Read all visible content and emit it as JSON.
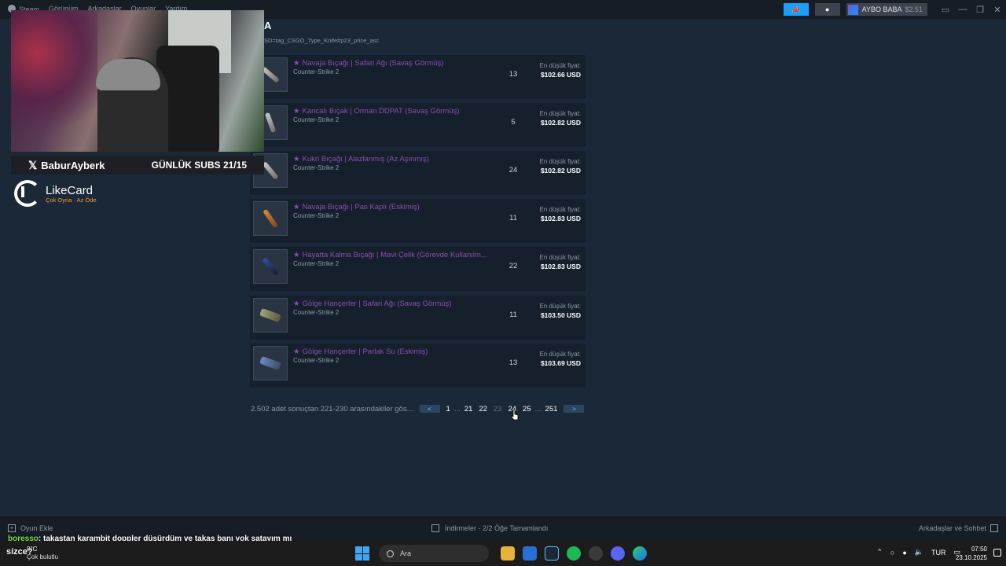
{
  "topbar": {
    "menu": [
      "Steam",
      "Görünüm",
      "Arkadaşlar",
      "Oyunlar",
      "Yardım"
    ],
    "username": "AYBO BABA",
    "balance": "$2.51"
  },
  "page": {
    "title": "A",
    "url_fragment": "SD=tag_CSGO_Type_Knife#p23_price_asc"
  },
  "listings": [
    {
      "name": "Navaja Bıçağı | Safari Ağı (Savaş Görmüş)",
      "game": "Counter-Strike 2",
      "qty": "13",
      "price_label": "En düşük fiyat:",
      "price": "$102.66 USD"
    },
    {
      "name": "Kancalı Bıçak | Orman DDPAT (Savaş Görmüş)",
      "game": "Counter-Strike 2",
      "qty": "5",
      "price_label": "En düşük fiyat:",
      "price": "$102.82 USD"
    },
    {
      "name": "Kukri Bıçağı | Alazlanmış (Az Aşınmış)",
      "game": "Counter-Strike 2",
      "qty": "24",
      "price_label": "En düşük fiyat:",
      "price": "$102.82 USD"
    },
    {
      "name": "Navaja Bıçağı | Pas Kaplı (Eskimiş)",
      "game": "Counter-Strike 2",
      "qty": "11",
      "price_label": "En düşük fiyat:",
      "price": "$102.83 USD"
    },
    {
      "name": "Hayatta Kalma Bıçağı | Mavi Çelik (Görevde Kullanılm...",
      "game": "Counter-Strike 2",
      "qty": "22",
      "price_label": "En düşük fiyat:",
      "price": "$102.83 USD"
    },
    {
      "name": "Gölge Hançerler | Safari Ağı (Savaş Görmüş)",
      "game": "Counter-Strike 2",
      "qty": "11",
      "price_label": "En düşük fiyat:",
      "price": "$103.50 USD"
    },
    {
      "name": "Gölge Hançerler | Parlak Su (Eskimiş)",
      "game": "Counter-Strike 2",
      "qty": "13",
      "price_label": "En düşük fiyat:",
      "price": "$103.69 USD"
    }
  ],
  "pagination": {
    "summary": "2.502 adet sonuçtan 221-230 arasındakiler gös...",
    "prev": "<",
    "next": ">",
    "pages": [
      "1",
      "...",
      "21",
      "22",
      "23",
      "24",
      "25",
      "...",
      "251"
    ],
    "current": "23"
  },
  "overlay": {
    "handle": "BaburAyberk",
    "subs": "GÜNLÜK SUBS 21/15",
    "sponsor": "LikeCard",
    "sponsor_tagline": "Çok Oyna · Az Öde"
  },
  "statusbar": {
    "add_game": "Oyun Ekle",
    "downloads": "İndirmeler - 2/2 Öğe Tamamlandı",
    "friends": "Arkadaşlar ve Sohbet"
  },
  "chat": {
    "user": "boresso",
    "message": ": takastan karambit doppler düşürdüm ve takas banı yok satayım mı",
    "line2": "sizce?"
  },
  "taskbar": {
    "temp": "8°C",
    "weather": "Çok bulutlu",
    "search": "Ara",
    "lang": "TUR",
    "time": "07:50",
    "date": "23.10.2025"
  },
  "colors": {
    "background": "#1b2838",
    "item_name": "#8650ac",
    "accent": "#1a9fff"
  }
}
